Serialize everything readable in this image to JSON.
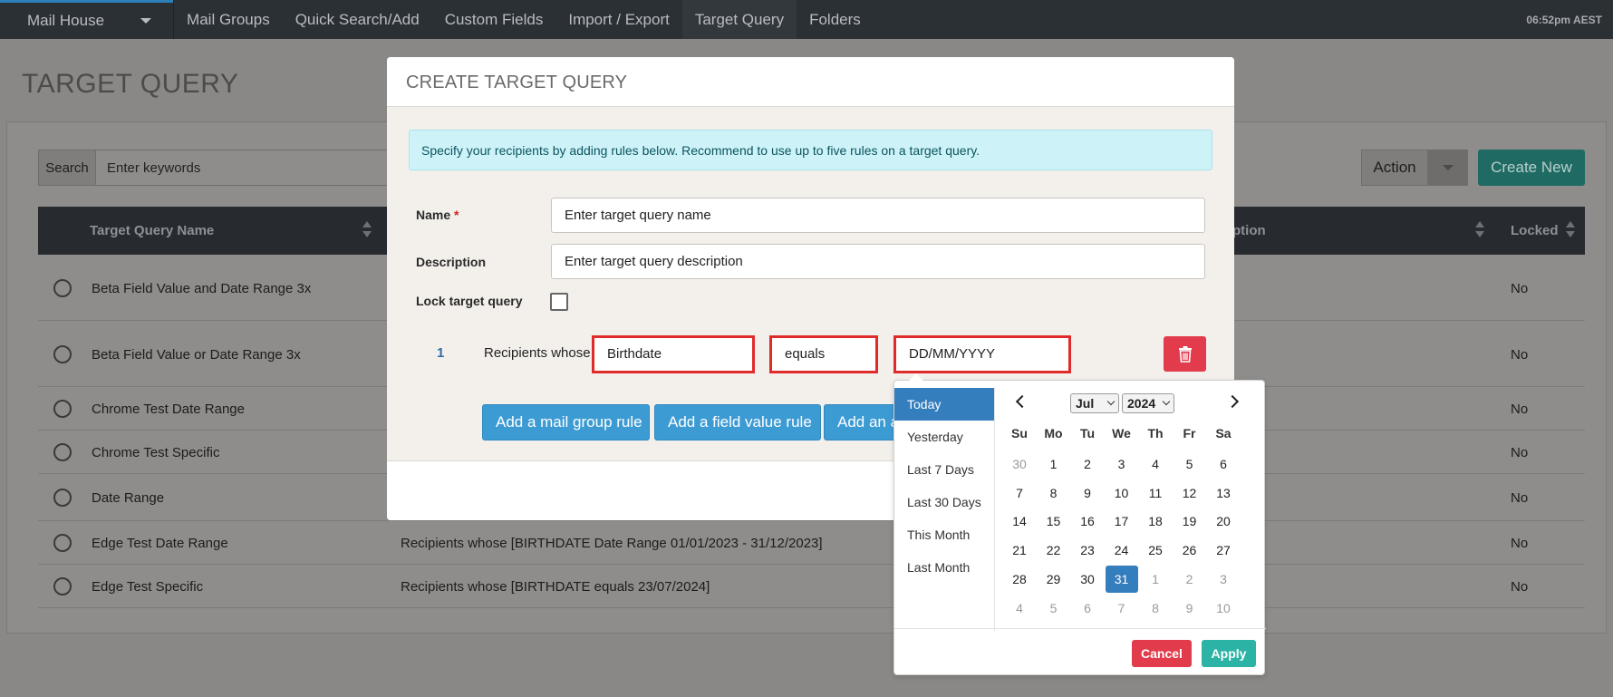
{
  "nav": {
    "brand": "Mail House",
    "items": [
      "Mail Groups",
      "Quick Search/Add",
      "Custom Fields",
      "Import / Export",
      "Target Query",
      "Folders"
    ],
    "time": "06:52pm AEST"
  },
  "page": {
    "title": "TARGET QUERY",
    "search_label": "Search",
    "search_placeholder": "Enter keywords",
    "action_label": "Action",
    "create_label": "Create New"
  },
  "table": {
    "headers": {
      "name": "Target Query Name",
      "description": "ription",
      "locked": "Locked"
    },
    "rows": [
      {
        "name": "Beta Field Value and Date Range 3x",
        "description": "",
        "locked": "No"
      },
      {
        "name": "Beta Field Value or Date Range 3x",
        "description": "",
        "locked": "No"
      },
      {
        "name": "Chrome Test Date Range",
        "description": "",
        "locked": "No"
      },
      {
        "name": "Chrome Test Specific",
        "description": "",
        "locked": "No"
      },
      {
        "name": "Date Range",
        "description": "",
        "locked": "No"
      },
      {
        "name": "Edge Test Date Range",
        "description": "Recipients whose [BIRTHDATE Date Range 01/01/2023 - 31/12/2023]",
        "locked": "No"
      },
      {
        "name": "Edge Test Specific",
        "description": "Recipients whose [BIRTHDATE equals 23/07/2024]",
        "locked": "No"
      }
    ]
  },
  "modal": {
    "title": "CREATE TARGET QUERY",
    "info": "Specify your recipients by adding rules below. Recommend to use up to five rules on a target query.",
    "name_label": "Name",
    "required_mark": "*",
    "name_placeholder": "Enter target query name",
    "description_label": "Description",
    "description_placeholder": "Enter target query description",
    "lock_label": "Lock target query",
    "rule": {
      "number": "1",
      "prefix": "Recipients whose",
      "field": "Birthdate",
      "operator": "equals",
      "value_placeholder": "DD/MM/YYYY"
    },
    "buttons": [
      "Add a mail group rule",
      "Add a field value rule",
      "Add an a"
    ]
  },
  "datepicker": {
    "ranges": [
      "Today",
      "Yesterday",
      "Last 7 Days",
      "Last 30 Days",
      "This Month",
      "Last Month"
    ],
    "active_range": "Today",
    "month": "Jul",
    "year": "2024",
    "weekdays": [
      "Su",
      "Mo",
      "Tu",
      "We",
      "Th",
      "Fr",
      "Sa"
    ],
    "weeks": [
      [
        "30",
        "1",
        "2",
        "3",
        "4",
        "5",
        "6"
      ],
      [
        "7",
        "8",
        "9",
        "10",
        "11",
        "12",
        "13"
      ],
      [
        "14",
        "15",
        "16",
        "17",
        "18",
        "19",
        "20"
      ],
      [
        "21",
        "22",
        "23",
        "24",
        "25",
        "26",
        "27"
      ],
      [
        "28",
        "29",
        "30",
        "31",
        "1",
        "2",
        "3"
      ],
      [
        "4",
        "5",
        "6",
        "7",
        "8",
        "9",
        "10"
      ]
    ],
    "selected_day": "31",
    "cancel_label": "Cancel",
    "apply_label": "Apply"
  },
  "colors": {
    "nav_bg": "#2b3035",
    "primary": "#3d9bd3",
    "danger": "#e23b4b",
    "teal": "#2bb3a6",
    "highlight_blue": "#357ebd"
  }
}
